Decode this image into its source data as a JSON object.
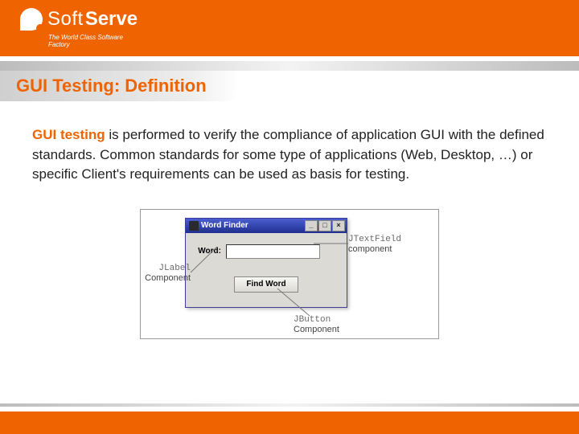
{
  "brand": {
    "name1": "Soft",
    "name2": "Serve",
    "tagline": "The World Class Software Factory"
  },
  "title": "GUI Testing: Definition",
  "para": {
    "lead": "GUI testing",
    "rest": " is performed to verify the compliance of application GUI with the defined standards. Common standards for some type of applications (Web, Desktop, …) or specific Client's requirements can be used as basis for testing."
  },
  "win": {
    "title": "Word Finder",
    "label": "Word:",
    "btn": "Find Word",
    "min": "_",
    "max": "□",
    "close": "×"
  },
  "ann": {
    "textfield_type": "JTextField",
    "textfield_word": "component",
    "label_type": "JLabel",
    "label_word": "Component",
    "button_type": "JButton",
    "button_word": "Component"
  }
}
